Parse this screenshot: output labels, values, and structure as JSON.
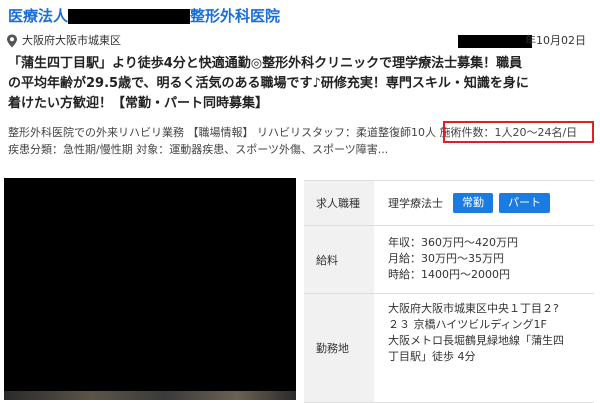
{
  "header": {
    "title_prefix": "医療法人",
    "title_suffix": "整形外科医院",
    "location": "大阪府大阪市城東区",
    "date": "年10月02日"
  },
  "headline": {
    "lines": [
      "「蒲生四丁目駅」より徒歩4分と快適通勤◎整形外科クリニックで理学療法士募集！職員",
      "の平均年齢が29.5歳で、明るく活気のある職場です♪研修充実！専門スキル・知識を身に",
      "着けたい方歓迎！【常勤・パート同時募集】"
    ]
  },
  "description": {
    "line1": "整形外科医院での外来リハビリ業務 【職場情報】 リハビリスタッフ：柔道整復師10人 施術件数：1人20～24名/日",
    "line2": "疾患分類：急性期/慢性期 対象：運動器疾患、スポーツ外傷、スポーツ障害..."
  },
  "details": {
    "job_label": "求人職種",
    "job_name": "理学療法士",
    "tags": [
      "常勤",
      "パート"
    ],
    "salary_label": "給料",
    "salary_lines": [
      "年収：360万円〜420万円",
      "月給：30万円〜35万円",
      "時給：1400円〜2000円"
    ],
    "location_label": "勤務地",
    "address_lines": [
      "大阪府大阪市城東区中央１丁目２?",
      "２３ 京橋ハイツビルディング1F",
      "大阪メトロ長堀鶴見緑地線「蒲生四",
      "丁目駅」徒歩 4分"
    ]
  },
  "colors": {
    "title_blue": "#1a6ed8",
    "tag_blue": "#1a7be0",
    "highlight_red": "#e01e2a",
    "label_bg": "#f1f1f1"
  },
  "icons": {
    "location": "map-pin-icon"
  }
}
